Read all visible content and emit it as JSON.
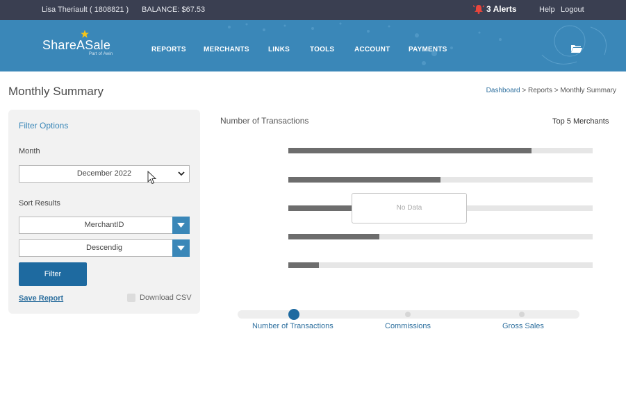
{
  "topbar": {
    "user": "Lisa Theriault ( 1808821 )",
    "balance": "BALANCE: $67.53",
    "alerts": "3 Alerts",
    "help": "Help",
    "logout": "Logout"
  },
  "header": {
    "logo": "ShareASale",
    "logo_sub": "Part of Awin",
    "nav": [
      "REPORTS",
      "MERCHANTS",
      "LINKS",
      "TOOLS",
      "ACCOUNT",
      "PAYMENTS"
    ]
  },
  "page": {
    "title": "Monthly Summary",
    "breadcrumb": {
      "home": "Dashboard",
      "sep1": " > ",
      "reports": "Reports",
      "sep2": " > ",
      "current": "Monthly Summary"
    }
  },
  "filter": {
    "title": "Filter Options",
    "month_label": "Month",
    "month_value": "December 2022",
    "sort_label": "Sort Results",
    "sort_field": "MerchantID",
    "sort_order": "Descendig",
    "filter_button": "Filter",
    "save_report": "Save Report",
    "download_csv": "Download CSV"
  },
  "chart": {
    "title": "Number of Transactions",
    "top_label": "Top 5 Merchants",
    "no_data": "No Data",
    "bars": [
      0.8,
      0.5,
      0.21,
      0.3,
      0.1
    ]
  },
  "view_selector": {
    "options": [
      "Number of Transactions",
      "Commissions",
      "Gross Sales"
    ],
    "selected": "Number of Transactions"
  },
  "colors": {
    "topbar": "#3a3f51",
    "header": "#3a87b8",
    "primary_button": "#1e6aa0",
    "link": "#2d6f9e",
    "alert": "#e8453c"
  }
}
